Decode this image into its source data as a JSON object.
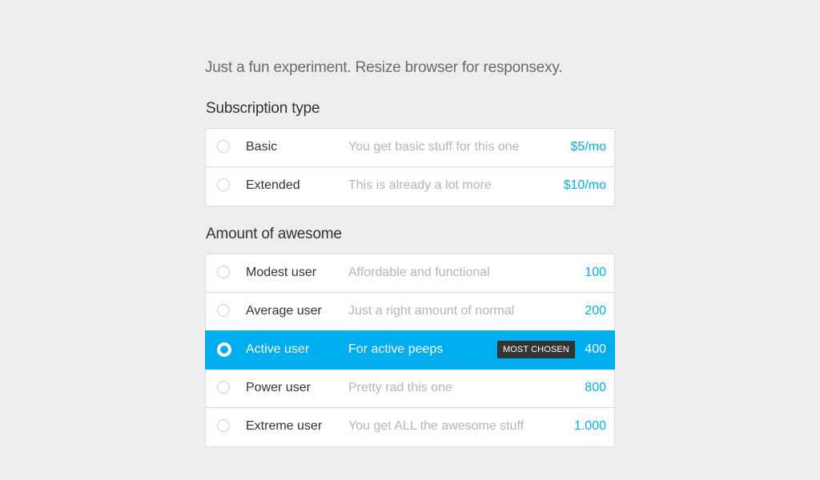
{
  "intro": "Just a fun experiment. Resize browser for responsexy.",
  "sections": [
    {
      "title": "Subscription type",
      "options": [
        {
          "label": "Basic",
          "description": "You get basic stuff for this one",
          "price": "$5/mo",
          "selected": false
        },
        {
          "label": "Extended",
          "description": "This is already a lot more",
          "price": "$10/mo",
          "selected": false
        }
      ]
    },
    {
      "title": "Amount of awesome",
      "options": [
        {
          "label": "Modest user",
          "description": "Affordable and functional",
          "price": "100",
          "selected": false
        },
        {
          "label": "Average user",
          "description": "Just a right amount of normal",
          "price": "200",
          "selected": false
        },
        {
          "label": "Active user",
          "description": "For active peeps",
          "price": "400",
          "selected": true,
          "badge": "MOST CHOSEN"
        },
        {
          "label": "Power user",
          "description": "Pretty rad this one",
          "price": "800",
          "selected": false
        },
        {
          "label": "Extreme user",
          "description": "You get ALL the awesome stuff",
          "price": "1.000",
          "selected": false
        }
      ]
    }
  ],
  "colors": {
    "accent": "#00aeef",
    "background": "#eeeeee",
    "badge_bg": "#333333",
    "muted_text": "#b5b5b5",
    "primary_text": "#333333"
  }
}
